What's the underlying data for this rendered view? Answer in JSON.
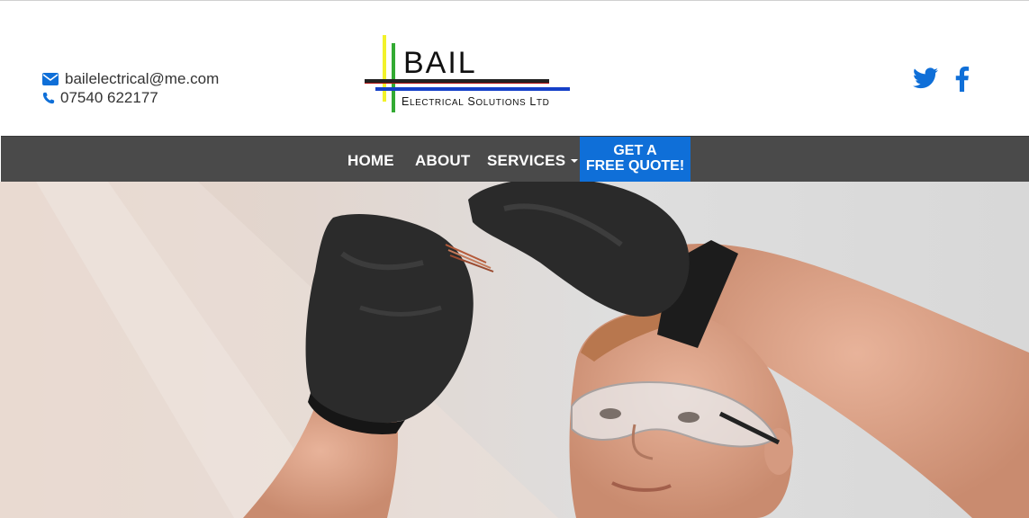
{
  "contact": {
    "email": "bailelectrical@me.com",
    "phone": "07540 622177"
  },
  "logo": {
    "name": "BAIL",
    "tagline": "Electrical Solutions Ltd"
  },
  "social": {
    "twitter_icon": "twitter-icon",
    "facebook_icon": "facebook-icon"
  },
  "nav": {
    "home": "HOME",
    "about": "ABOUT",
    "services": "SERVICES",
    "quote_line1": "GET A",
    "quote_line2": "FREE QUOTE!"
  },
  "colors": {
    "accent": "#0f6fd8",
    "nav_bg": "#4a4a4a",
    "text": "#333333"
  }
}
